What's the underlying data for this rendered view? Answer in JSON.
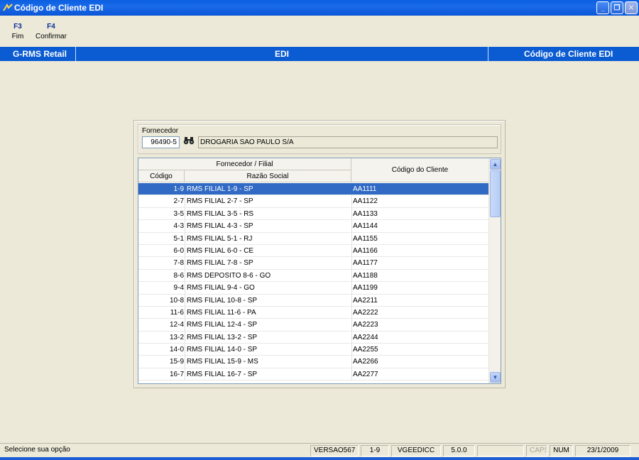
{
  "window": {
    "title": "Código de Cliente EDI"
  },
  "function_keys": [
    {
      "key": "F3",
      "label": "Fim"
    },
    {
      "key": "F4",
      "label": "Confirmar"
    }
  ],
  "navbar": {
    "left": "G-RMS Retail",
    "center": "EDI",
    "right": "Código de Cliente EDI"
  },
  "fornecedor": {
    "label": "Fornecedor",
    "code": "96490-5",
    "name": "DROGARIA SAO PAULO S/A"
  },
  "grid": {
    "group_header": "Fornecedor / Filial",
    "col_codigo": "Código",
    "col_razao": "Razão Social",
    "col_cliente": "Código do Cliente",
    "selected_index": 0,
    "rows": [
      {
        "codigo": "1-9",
        "razao": "RMS FILIAL 1-9 - SP",
        "cliente": "AA1111"
      },
      {
        "codigo": "2-7",
        "razao": "RMS FILIAL 2-7 - SP",
        "cliente": "AA1122"
      },
      {
        "codigo": "3-5",
        "razao": "RMS FILIAL 3-5 - RS",
        "cliente": "AA1133"
      },
      {
        "codigo": "4-3",
        "razao": "RMS FILIAL 4-3 - SP",
        "cliente": "AA1144"
      },
      {
        "codigo": "5-1",
        "razao": "RMS FILIAL 5-1 - RJ",
        "cliente": "AA1155"
      },
      {
        "codigo": "6-0",
        "razao": "RMS FILIAL 6-0 - CE",
        "cliente": "AA1166"
      },
      {
        "codigo": "7-8",
        "razao": "RMS FILIAL 7-8 - SP",
        "cliente": "AA1177"
      },
      {
        "codigo": "8-6",
        "razao": "RMS DEPOSITO 8-6 - GO",
        "cliente": "AA1188"
      },
      {
        "codigo": "9-4",
        "razao": "RMS FILIAL 9-4 - GO",
        "cliente": "AA1199"
      },
      {
        "codigo": "10-8",
        "razao": "RMS FILIAL 10-8 - SP",
        "cliente": "AA2211"
      },
      {
        "codigo": "11-6",
        "razao": "RMS FILIAL 11-6 - PA",
        "cliente": "AA2222"
      },
      {
        "codigo": "12-4",
        "razao": "RMS FILIAL 12-4 - SP",
        "cliente": "AA2223"
      },
      {
        "codigo": "13-2",
        "razao": "RMS FILIAL 13-2 - SP",
        "cliente": "AA2244"
      },
      {
        "codigo": "14-0",
        "razao": "RMS FILIAL 14-0 - SP",
        "cliente": "AA2255"
      },
      {
        "codigo": "15-9",
        "razao": "RMS FILIAL 15-9 - MS",
        "cliente": "AA2266"
      },
      {
        "codigo": "16-7",
        "razao": "RMS FILIAL 16-7 - SP",
        "cliente": "AA2277"
      }
    ]
  },
  "statusbar": {
    "message": "Selecione sua opção",
    "version": "VERSAO567",
    "filial": "1-9",
    "program": "VGEEDICC",
    "release": "5.0.0",
    "empty": "",
    "caps": "CAPS",
    "num": "NUM",
    "date": "23/1/2009"
  },
  "colors": {
    "accent": "#0b5bd2",
    "selection": "#316ac5",
    "background": "#ece9d8"
  },
  "icons": {
    "search": "binoculars-icon"
  }
}
